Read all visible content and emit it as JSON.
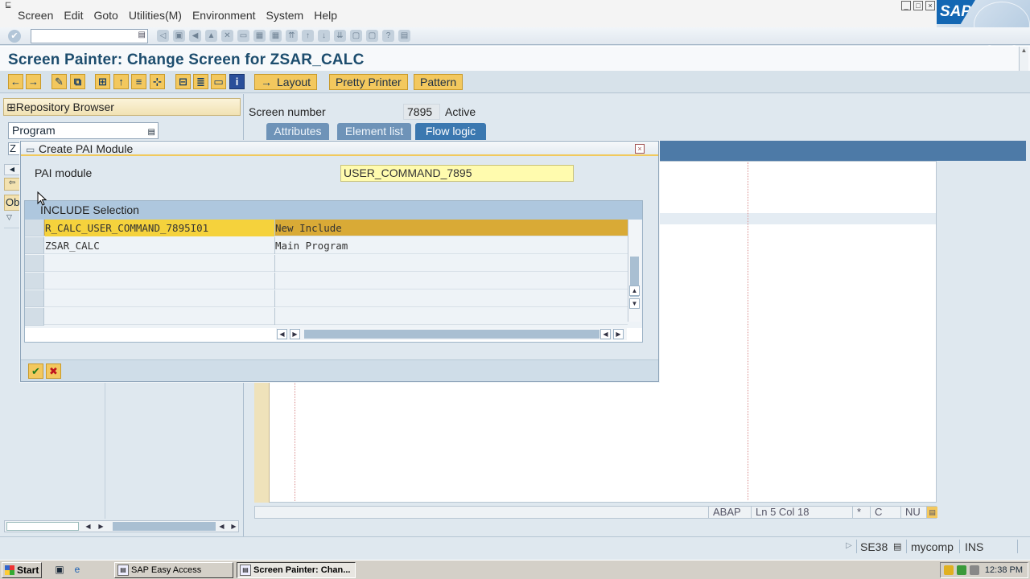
{
  "menubar": {
    "items": [
      "Screen",
      "Edit",
      "Goto",
      "Utilities(M)",
      "Environment",
      "System",
      "Help"
    ],
    "brand": "SAP"
  },
  "title": "Screen Painter: Change Screen for ZSAR_CALC",
  "app_toolbar": {
    "layout_label": "Layout",
    "pretty_printer_label": "Pretty Printer",
    "pattern_label": "Pattern"
  },
  "repository": {
    "header": "Repository Browser",
    "object_type": "Program",
    "object_name_start": "Z",
    "object_list_start": "Ob"
  },
  "screen": {
    "number_label": "Screen number",
    "number": "7895",
    "status": "Active",
    "tabs": [
      "Attributes",
      "Element list",
      "Flow logic"
    ],
    "active_tab": "Flow logic"
  },
  "editor_status": {
    "language": "ABAP",
    "position": "Ln  5 Col 18",
    "c": "C",
    "nu": "NU"
  },
  "dialog": {
    "title": "Create PAI Module",
    "pai_label": "PAI module",
    "pai_value": "USER_COMMAND_7895",
    "grid_title": "INCLUDE Selection",
    "rows": [
      {
        "name": "R_CALC_USER_COMMAND_7895I01",
        "desc": "New Include"
      },
      {
        "name": "ZSAR_CALC",
        "desc": "Main Program"
      }
    ]
  },
  "statusbar": {
    "transaction": "SE38",
    "server": "mycomp",
    "mode": "INS"
  },
  "taskbar": {
    "start": "Start",
    "tasks": [
      "SAP Easy Access",
      "Screen Painter: Chan..."
    ],
    "clock": "12:38 PM"
  },
  "colors": {
    "accent_yellow": "#f3c85e",
    "tab_active": "#3b78b0",
    "title_blue": "#1d4d6e",
    "row_highlight": "#d9aa36"
  }
}
